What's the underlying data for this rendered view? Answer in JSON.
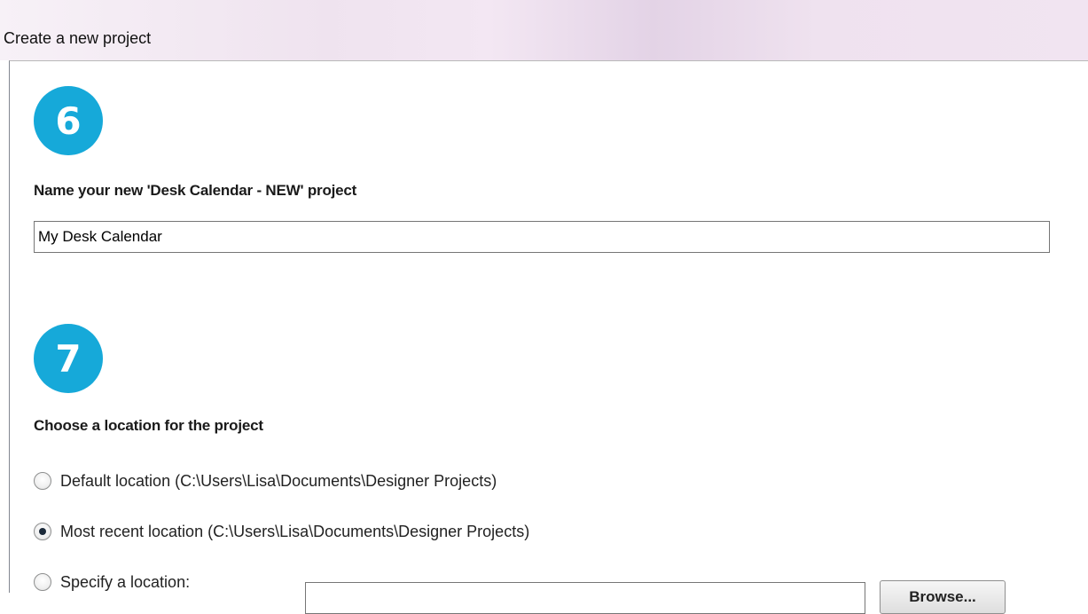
{
  "window": {
    "title": "Create a new project"
  },
  "step_name": {
    "number": "6",
    "heading": "Name your new 'Desk Calendar - NEW' project",
    "project_name_value": "My Desk Calendar"
  },
  "step_location": {
    "number": "7",
    "heading": "Choose a location for the project",
    "options": [
      {
        "label": "Default location (C:\\Users\\Lisa\\Documents\\Designer Projects)",
        "selected": false
      },
      {
        "label": "Most recent location (C:\\Users\\Lisa\\Documents\\Designer Projects)",
        "selected": true
      },
      {
        "label": "Specify a location:",
        "selected": false
      }
    ],
    "specified_path_value": "",
    "browse_label": "Browse..."
  },
  "colors": {
    "badge": "#16a9d9",
    "title_bar": "#efe3ef"
  }
}
